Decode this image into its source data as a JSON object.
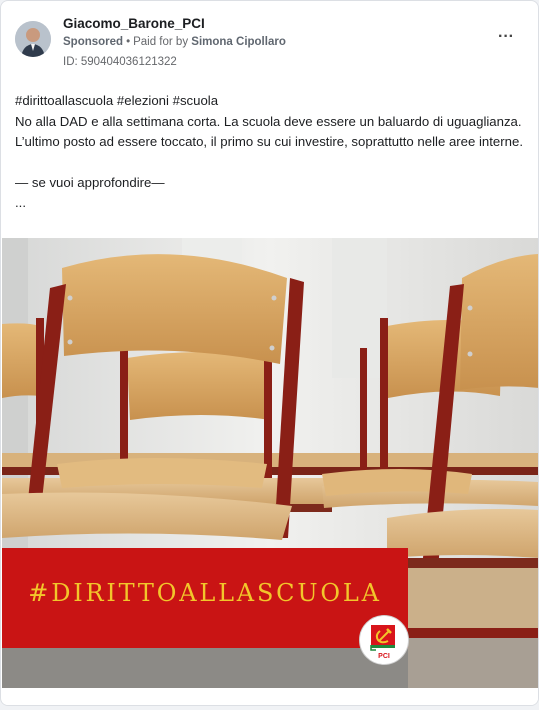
{
  "post": {
    "author": "Giacomo_Barone_PCI",
    "sponsored": "Sponsored",
    "paid_for_prefix": "Paid for by",
    "payer": "Simona Cipollaro",
    "ad_id": "ID: 590404036121322",
    "more_icon": "ellipsis-icon",
    "text": {
      "hashtags": "#dirittoallascuola #elezioni #scuola",
      "line1": "No alla DAD e alla settimana corta. La scuola deve essere un baluardo di uguaglianza. L’ultimo posto ad essere toccato, il primo su cui investire, soprattutto nelle aree interne.",
      "link": "— se vuoi approfondire—",
      "ellipsis": "..."
    }
  },
  "image": {
    "banner_text": "#DIRITTOALLASCUOLA",
    "logo_text": "PCI",
    "colors": {
      "banner": "#c91414",
      "banner_text": "#f2c62b",
      "chair_frame": "#8a1f16",
      "chair_wood": "#d9a866"
    }
  }
}
